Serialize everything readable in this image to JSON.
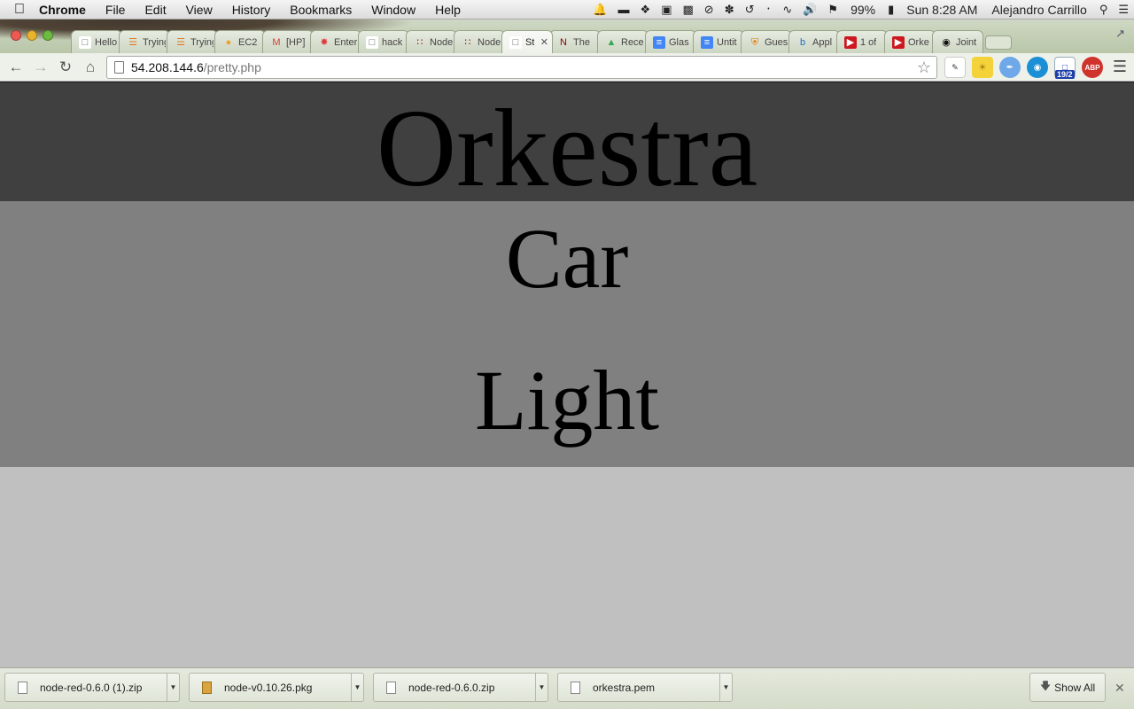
{
  "menubar": {
    "app": "Chrome",
    "items": [
      "File",
      "Edit",
      "View",
      "History",
      "Bookmarks",
      "Window",
      "Help"
    ],
    "battery": "99%",
    "clock": "Sun 8:28 AM",
    "user": "Alejandro Carrillo"
  },
  "tabs": [
    {
      "label": "Hello",
      "icon": "page-icon"
    },
    {
      "label": "Trying",
      "icon": "stackoverflow-icon"
    },
    {
      "label": "Trying",
      "icon": "stackoverflow-icon"
    },
    {
      "label": "EC2",
      "icon": "ec2-icon"
    },
    {
      "label": "[HP]",
      "icon": "gmail-icon"
    },
    {
      "label": "Enter",
      "icon": "puzzle-icon"
    },
    {
      "label": "hack",
      "icon": "page-icon"
    },
    {
      "label": "Node",
      "icon": "node-red-icon"
    },
    {
      "label": "Node",
      "icon": "node-red-icon"
    },
    {
      "label": "St",
      "icon": "page-icon",
      "active": true
    },
    {
      "label": "The",
      "icon": "n-icon"
    },
    {
      "label": "Rece",
      "icon": "drive-icon"
    },
    {
      "label": "Glas",
      "icon": "docs-icon"
    },
    {
      "label": "Untit",
      "icon": "docs-icon"
    },
    {
      "label": "Gues",
      "icon": "princeton-icon"
    },
    {
      "label": "Appl",
      "icon": "b-icon"
    },
    {
      "label": "1 of",
      "icon": "youtube-icon"
    },
    {
      "label": "Orke",
      "icon": "youtube-icon"
    },
    {
      "label": "Joint",
      "icon": "github-icon"
    }
  ],
  "omnibox": {
    "host": "54.208.144.6",
    "path": "/pretty.php"
  },
  "extensions": {
    "calendar_badge": "19/2",
    "abp_label": "ABP"
  },
  "page": {
    "title": "Orkestra",
    "devices": [
      "Car",
      "Light"
    ]
  },
  "downloads": {
    "items": [
      {
        "name": "node-red-0.6.0 (1).zip",
        "type": "file"
      },
      {
        "name": "node-v0.10.26.pkg",
        "type": "pkg"
      },
      {
        "name": "node-red-0.6.0.zip",
        "type": "file"
      },
      {
        "name": "orkestra.pem",
        "type": "file"
      }
    ],
    "show_all": "Show All"
  },
  "colors": {
    "header_bg": "#404040",
    "devices_bg": "#808080",
    "page_bg": "#c0c0c0"
  }
}
